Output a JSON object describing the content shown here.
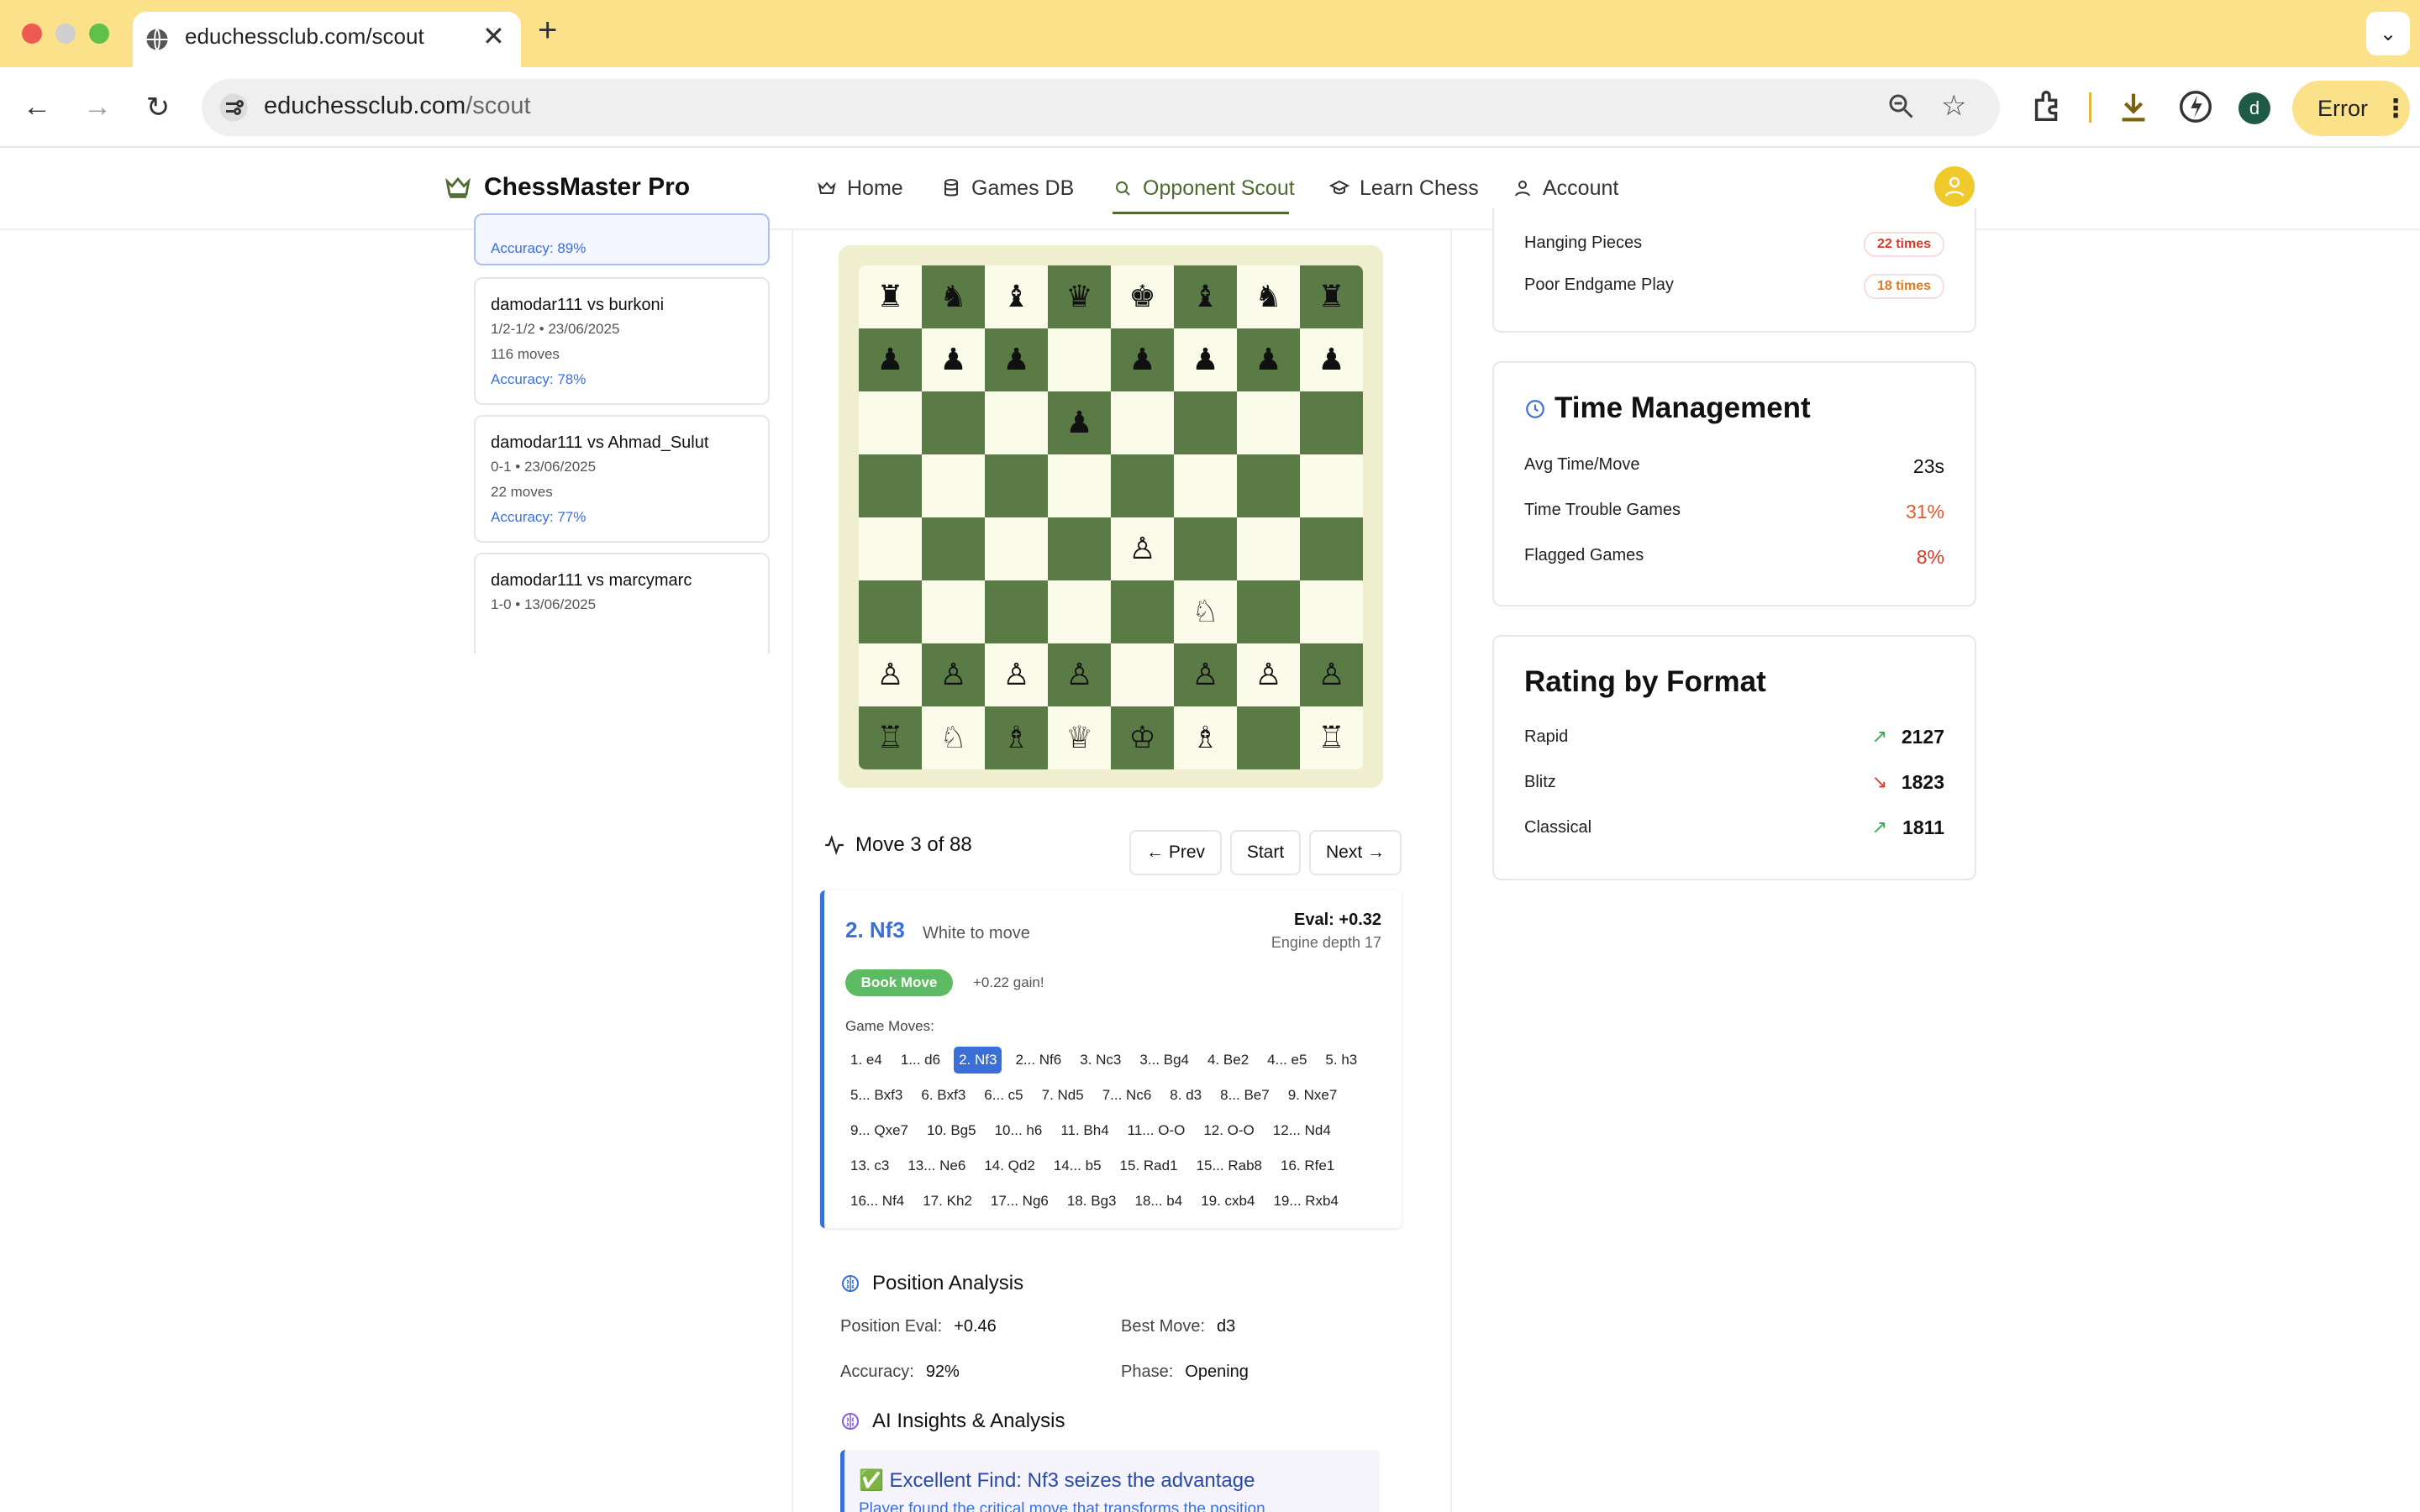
{
  "browser": {
    "tab_title": "educhessclub.com/scout",
    "url_domain": "educhessclub.com",
    "url_path": "/scout",
    "profile_initial": "d",
    "error_label": "Error"
  },
  "app": {
    "brand": "ChessMaster Pro",
    "nav": [
      {
        "label": "Home",
        "icon": "crown-icon"
      },
      {
        "label": "Games DB",
        "icon": "database-icon"
      },
      {
        "label": "Opponent Scout",
        "icon": "search-icon",
        "active": true
      },
      {
        "label": "Learn Chess",
        "icon": "graduation-cap-icon"
      },
      {
        "label": "Account",
        "icon": "user-icon"
      }
    ]
  },
  "games": [
    {
      "accuracy": "Accuracy: 89%"
    },
    {
      "title": "damodar111 vs burkoni",
      "meta": "1/2-1/2 • 23/06/2025",
      "moves": "116 moves",
      "accuracy": "Accuracy: 78%"
    },
    {
      "title": "damodar111 vs Ahmad_Sulut",
      "meta": "0-1 • 23/06/2025",
      "moves": "22 moves",
      "accuracy": "Accuracy: 77%"
    },
    {
      "title": "damodar111 vs marcymarc",
      "meta": "1-0 • 13/06/2025"
    }
  ],
  "board": [
    [
      "♜",
      "♞",
      "♝",
      "♛",
      "♚",
      "♝",
      "♞",
      "♜"
    ],
    [
      "♟",
      "♟",
      "♟",
      "",
      "♟",
      "♟",
      "♟",
      "♟"
    ],
    [
      "",
      "",
      "",
      "♟",
      "",
      "",
      "",
      ""
    ],
    [
      "",
      "",
      "",
      "",
      "",
      "",
      "",
      ""
    ],
    [
      "",
      "",
      "",
      "",
      "♙",
      "",
      "",
      ""
    ],
    [
      "",
      "",
      "",
      "",
      "",
      "♘",
      "",
      ""
    ],
    [
      "♙",
      "♙",
      "♙",
      "♙",
      "",
      "♙",
      "♙",
      "♙"
    ],
    [
      "♖",
      "♘",
      "♗",
      "♕",
      "♔",
      "♗",
      "",
      "♖"
    ]
  ],
  "move_nav": {
    "label": "Move 3 of 88",
    "prev": "← Prev",
    "start": "Start",
    "next": "Next →"
  },
  "current_move": {
    "name": "2. Nf3",
    "sub": "White to move",
    "eval": "Eval: +0.32",
    "depth": "Engine depth 17",
    "badge": "Book Move",
    "gain": "+0.22 gain!",
    "game_moves_label": "Game Moves:"
  },
  "move_rows": [
    [
      "1. e4",
      "1... d6",
      "2. Nf3",
      "2... Nf6",
      "3. Nc3",
      "3... Bg4",
      "4. Be2",
      "4... e5",
      "5. h3"
    ],
    [
      "5... Bxf3",
      "6. Bxf3",
      "6... c5",
      "7. Nd5",
      "7... Nc6",
      "8. d3",
      "8... Be7",
      "9. Nxe7"
    ],
    [
      "9... Qxe7",
      "10. Bg5",
      "10... h6",
      "11. Bh4",
      "11... O-O",
      "12. O-O",
      "12... Nd4"
    ],
    [
      "13. c3",
      "13... Ne6",
      "14. Qd2",
      "14... b5",
      "15. Rad1",
      "15... Rab8",
      "16. Rfe1"
    ],
    [
      "16... Nf4",
      "17. Kh2",
      "17... Ng6",
      "18. Bg3",
      "18... b4",
      "19. cxb4",
      "19... Rxb4"
    ]
  ],
  "current_move_index": 2,
  "position_analysis": {
    "title": "Position Analysis",
    "eval_label": "Position Eval:",
    "eval_value": "+0.46",
    "best_label": "Best Move:",
    "best_value": "d3",
    "acc_label": "Accuracy:",
    "acc_value": "92%",
    "phase_label": "Phase:",
    "phase_value": "Opening"
  },
  "ai": {
    "title": "AI Insights & Analysis",
    "insight_title": "✅ Excellent Find: Nf3 seizes the advantage",
    "insight_desc": "Player found the critical move that transforms the position"
  },
  "weaknesses": [
    {
      "label": "Hanging Pieces",
      "value": "22 times",
      "color": "#d9392b"
    },
    {
      "label": "Poor Endgame Play",
      "value": "18 times",
      "color": "#e07a1f"
    }
  ],
  "time_management": {
    "title": "Time Management",
    "rows": [
      {
        "label": "Avg Time/Move",
        "value": "23s",
        "color": "#111111"
      },
      {
        "label": "Time Trouble Games",
        "value": "31%",
        "color": "#e05a2b"
      },
      {
        "label": "Flagged Games",
        "value": "8%",
        "color": "#d9392b"
      }
    ]
  },
  "rating": {
    "title": "Rating by Format",
    "rows": [
      {
        "label": "Rapid",
        "value": "2127",
        "trend": "up"
      },
      {
        "label": "Blitz",
        "value": "1823",
        "trend": "down"
      },
      {
        "label": "Classical",
        "value": "1811",
        "trend": "up"
      }
    ]
  },
  "colors": {
    "accent": "#3b6fd8",
    "brand_green": "#4d6b2e",
    "board_dark": "#5a7b46",
    "board_light": "#fbfbe9"
  }
}
